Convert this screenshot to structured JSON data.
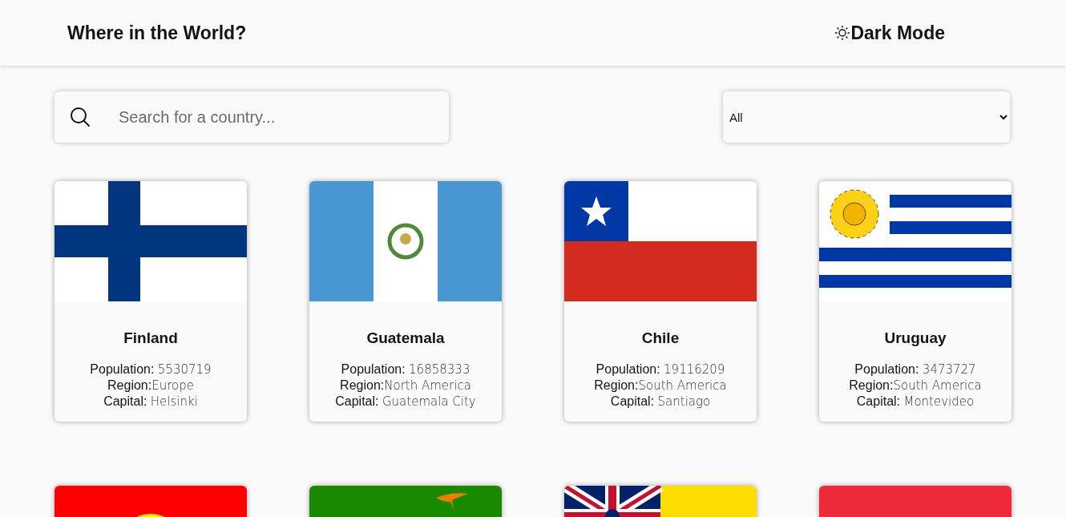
{
  "header": {
    "title": "Where in the World?",
    "mode_toggle": "Dark Mode"
  },
  "search": {
    "placeholder": "Search for a country..."
  },
  "region_filter": {
    "value": "All"
  },
  "countries": [
    {
      "kind": "finland",
      "name": "Finland",
      "details": [
        {
          "label": "Population: ",
          "value": "5530719"
        },
        {
          "label": "Region:",
          "value": "Europe"
        },
        {
          "label": "Capital: ",
          "value": "Helsinki"
        }
      ]
    },
    {
      "kind": "guatemala",
      "name": "Guatemala",
      "details": [
        {
          "label": "Population: ",
          "value": "16858333"
        },
        {
          "label": "Region:",
          "value": "North America"
        },
        {
          "label": "Capital: ",
          "value": "Guatemala City"
        }
      ]
    },
    {
      "kind": "chile",
      "name": "Chile",
      "details": [
        {
          "label": "Population: ",
          "value": "19116209"
        },
        {
          "label": "Region:",
          "value": "South America"
        },
        {
          "label": "Capital: ",
          "value": "Santiago"
        }
      ]
    },
    {
      "kind": "uruguay",
      "name": "Uruguay",
      "details": [
        {
          "label": "Population: ",
          "value": "3473727"
        },
        {
          "label": "Region:",
          "value": "South America"
        },
        {
          "label": "Capital: ",
          "value": "Montevideo"
        }
      ]
    },
    {
      "kind": "kyrgyzstan"
    },
    {
      "kind": "zambia"
    },
    {
      "kind": "niue"
    },
    {
      "kind": "red"
    }
  ]
}
